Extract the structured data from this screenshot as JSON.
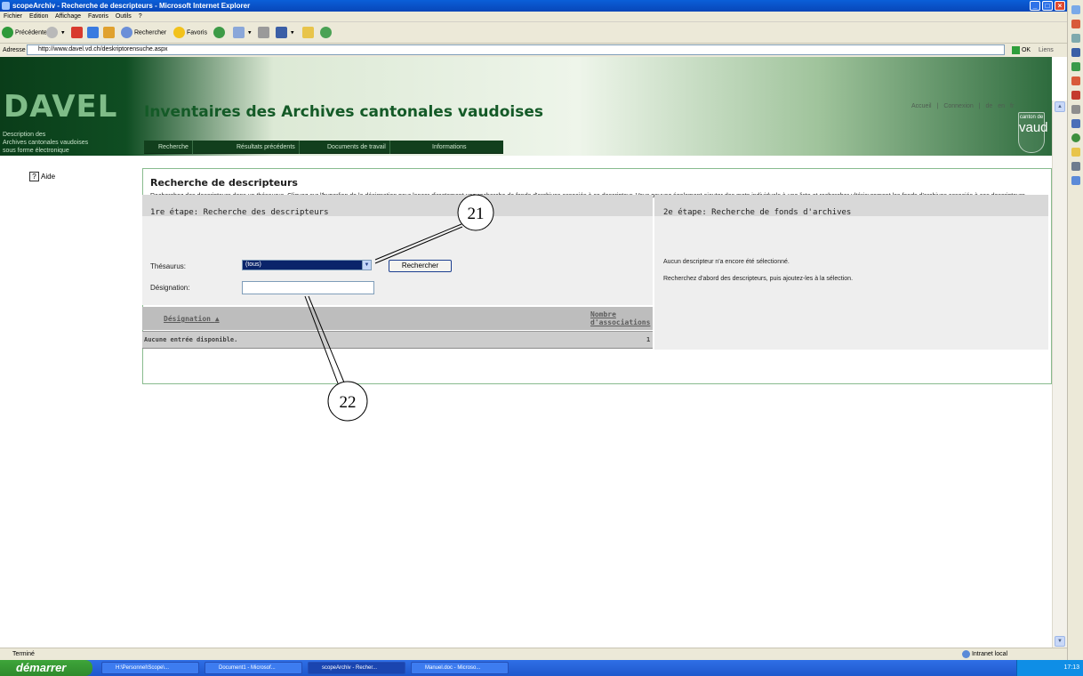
{
  "window": {
    "title": "scopeArchiv - Recherche de descripteurs - Microsoft Internet Explorer",
    "menu": [
      "Fichier",
      "Edition",
      "Affichage",
      "Favoris",
      "Outils",
      "?"
    ],
    "toolbar": {
      "back": "Précédente",
      "search": "Rechercher",
      "favorites": "Favoris"
    },
    "address_label": "Adresse",
    "url": "http://www.davel.vd.ch/deskriptorensuche.aspx",
    "go": "OK",
    "links": "Liens",
    "status_left": "Terminé",
    "status_zone": "Intranet local"
  },
  "site": {
    "logo": "DAVEL",
    "subtitle_lines": [
      "Description des",
      "Archives cantonales vaudoises",
      "sous forme électronique"
    ],
    "title": "Inventaires des Archives cantonales vaudoises",
    "nav": [
      "Recherche",
      "Résultats précédents",
      "Documents de travail",
      "Informations"
    ],
    "top_links": [
      "Accueil",
      "|",
      "Connexion",
      "|",
      "de",
      "en",
      "fr"
    ],
    "canton_badge_small": "canton de",
    "canton_badge": "vaud"
  },
  "help": {
    "label": "Aide",
    "icon": "?"
  },
  "content": {
    "heading": "Recherche de descripteurs",
    "intro": "Recherchez des descripteurs dans un thésaurus. Cliquez sur l'hyperlien de la désignation pour lancer directement une recherche de fonds d'archives associés à ce descripteur. Vous pouvez également ajouter des mots individuels à une liste et rechercher ultérieurement les fonds d'archives associés à ces descripteurs.",
    "step1": {
      "title": "1re étape: Recherche des descripteurs",
      "thesaurus_label": "Thésaurus:",
      "thesaurus_value": "(tous)",
      "search_button": "Rechercher",
      "designation_label": "Désignation:",
      "designation_value": "",
      "table": {
        "col_designation": "Désignation",
        "col_count_line1": "Nombre",
        "col_count_line2": "d'associations",
        "row_text": "Aucune entrée disponible.",
        "row_count": "1"
      }
    },
    "step2": {
      "title": "2e étape: Recherche de fonds d'archives",
      "line1": "Aucun descripteur n'a encore été sélectionné.",
      "line2": "Recherchez d'abord des descripteurs, puis ajoutez-les à la sélection."
    }
  },
  "callouts": [
    "21",
    "22"
  ],
  "taskbar": {
    "start": "démarrer",
    "tasks": [
      "H:\\Personnel\\Scope\\...",
      "Document1 - Microsof...",
      "scopeArchiv - Recher...",
      "Manuel.doc - Microso..."
    ],
    "clock": "17:13"
  }
}
